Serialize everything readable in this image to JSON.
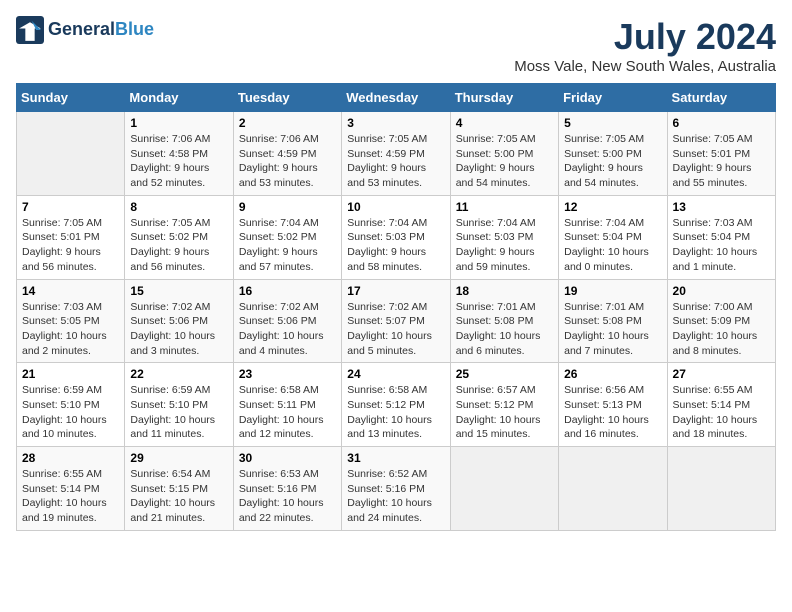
{
  "logo": {
    "line1": "General",
    "line2": "Blue"
  },
  "title": "July 2024",
  "location": "Moss Vale, New South Wales, Australia",
  "days_of_week": [
    "Sunday",
    "Monday",
    "Tuesday",
    "Wednesday",
    "Thursday",
    "Friday",
    "Saturday"
  ],
  "weeks": [
    [
      {
        "num": "",
        "lines": []
      },
      {
        "num": "1",
        "lines": [
          "Sunrise: 7:06 AM",
          "Sunset: 4:58 PM",
          "Daylight: 9 hours",
          "and 52 minutes."
        ]
      },
      {
        "num": "2",
        "lines": [
          "Sunrise: 7:06 AM",
          "Sunset: 4:59 PM",
          "Daylight: 9 hours",
          "and 53 minutes."
        ]
      },
      {
        "num": "3",
        "lines": [
          "Sunrise: 7:05 AM",
          "Sunset: 4:59 PM",
          "Daylight: 9 hours",
          "and 53 minutes."
        ]
      },
      {
        "num": "4",
        "lines": [
          "Sunrise: 7:05 AM",
          "Sunset: 5:00 PM",
          "Daylight: 9 hours",
          "and 54 minutes."
        ]
      },
      {
        "num": "5",
        "lines": [
          "Sunrise: 7:05 AM",
          "Sunset: 5:00 PM",
          "Daylight: 9 hours",
          "and 54 minutes."
        ]
      },
      {
        "num": "6",
        "lines": [
          "Sunrise: 7:05 AM",
          "Sunset: 5:01 PM",
          "Daylight: 9 hours",
          "and 55 minutes."
        ]
      }
    ],
    [
      {
        "num": "7",
        "lines": [
          "Sunrise: 7:05 AM",
          "Sunset: 5:01 PM",
          "Daylight: 9 hours",
          "and 56 minutes."
        ]
      },
      {
        "num": "8",
        "lines": [
          "Sunrise: 7:05 AM",
          "Sunset: 5:02 PM",
          "Daylight: 9 hours",
          "and 56 minutes."
        ]
      },
      {
        "num": "9",
        "lines": [
          "Sunrise: 7:04 AM",
          "Sunset: 5:02 PM",
          "Daylight: 9 hours",
          "and 57 minutes."
        ]
      },
      {
        "num": "10",
        "lines": [
          "Sunrise: 7:04 AM",
          "Sunset: 5:03 PM",
          "Daylight: 9 hours",
          "and 58 minutes."
        ]
      },
      {
        "num": "11",
        "lines": [
          "Sunrise: 7:04 AM",
          "Sunset: 5:03 PM",
          "Daylight: 9 hours",
          "and 59 minutes."
        ]
      },
      {
        "num": "12",
        "lines": [
          "Sunrise: 7:04 AM",
          "Sunset: 5:04 PM",
          "Daylight: 10 hours",
          "and 0 minutes."
        ]
      },
      {
        "num": "13",
        "lines": [
          "Sunrise: 7:03 AM",
          "Sunset: 5:04 PM",
          "Daylight: 10 hours",
          "and 1 minute."
        ]
      }
    ],
    [
      {
        "num": "14",
        "lines": [
          "Sunrise: 7:03 AM",
          "Sunset: 5:05 PM",
          "Daylight: 10 hours",
          "and 2 minutes."
        ]
      },
      {
        "num": "15",
        "lines": [
          "Sunrise: 7:02 AM",
          "Sunset: 5:06 PM",
          "Daylight: 10 hours",
          "and 3 minutes."
        ]
      },
      {
        "num": "16",
        "lines": [
          "Sunrise: 7:02 AM",
          "Sunset: 5:06 PM",
          "Daylight: 10 hours",
          "and 4 minutes."
        ]
      },
      {
        "num": "17",
        "lines": [
          "Sunrise: 7:02 AM",
          "Sunset: 5:07 PM",
          "Daylight: 10 hours",
          "and 5 minutes."
        ]
      },
      {
        "num": "18",
        "lines": [
          "Sunrise: 7:01 AM",
          "Sunset: 5:08 PM",
          "Daylight: 10 hours",
          "and 6 minutes."
        ]
      },
      {
        "num": "19",
        "lines": [
          "Sunrise: 7:01 AM",
          "Sunset: 5:08 PM",
          "Daylight: 10 hours",
          "and 7 minutes."
        ]
      },
      {
        "num": "20",
        "lines": [
          "Sunrise: 7:00 AM",
          "Sunset: 5:09 PM",
          "Daylight: 10 hours",
          "and 8 minutes."
        ]
      }
    ],
    [
      {
        "num": "21",
        "lines": [
          "Sunrise: 6:59 AM",
          "Sunset: 5:10 PM",
          "Daylight: 10 hours",
          "and 10 minutes."
        ]
      },
      {
        "num": "22",
        "lines": [
          "Sunrise: 6:59 AM",
          "Sunset: 5:10 PM",
          "Daylight: 10 hours",
          "and 11 minutes."
        ]
      },
      {
        "num": "23",
        "lines": [
          "Sunrise: 6:58 AM",
          "Sunset: 5:11 PM",
          "Daylight: 10 hours",
          "and 12 minutes."
        ]
      },
      {
        "num": "24",
        "lines": [
          "Sunrise: 6:58 AM",
          "Sunset: 5:12 PM",
          "Daylight: 10 hours",
          "and 13 minutes."
        ]
      },
      {
        "num": "25",
        "lines": [
          "Sunrise: 6:57 AM",
          "Sunset: 5:12 PM",
          "Daylight: 10 hours",
          "and 15 minutes."
        ]
      },
      {
        "num": "26",
        "lines": [
          "Sunrise: 6:56 AM",
          "Sunset: 5:13 PM",
          "Daylight: 10 hours",
          "and 16 minutes."
        ]
      },
      {
        "num": "27",
        "lines": [
          "Sunrise: 6:55 AM",
          "Sunset: 5:14 PM",
          "Daylight: 10 hours",
          "and 18 minutes."
        ]
      }
    ],
    [
      {
        "num": "28",
        "lines": [
          "Sunrise: 6:55 AM",
          "Sunset: 5:14 PM",
          "Daylight: 10 hours",
          "and 19 minutes."
        ]
      },
      {
        "num": "29",
        "lines": [
          "Sunrise: 6:54 AM",
          "Sunset: 5:15 PM",
          "Daylight: 10 hours",
          "and 21 minutes."
        ]
      },
      {
        "num": "30",
        "lines": [
          "Sunrise: 6:53 AM",
          "Sunset: 5:16 PM",
          "Daylight: 10 hours",
          "and 22 minutes."
        ]
      },
      {
        "num": "31",
        "lines": [
          "Sunrise: 6:52 AM",
          "Sunset: 5:16 PM",
          "Daylight: 10 hours",
          "and 24 minutes."
        ]
      },
      {
        "num": "",
        "lines": []
      },
      {
        "num": "",
        "lines": []
      },
      {
        "num": "",
        "lines": []
      }
    ]
  ]
}
